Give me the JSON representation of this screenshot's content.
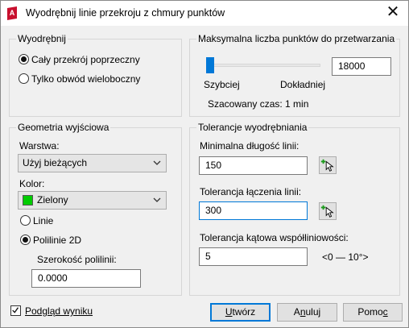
{
  "window": {
    "title": "Wyodrębnij linie przekroju z chmury punktów",
    "close_glyph": "✕"
  },
  "extract": {
    "title": "Wyodrębnij",
    "options": [
      {
        "label": "Cały przekrój poprzeczny",
        "selected": true
      },
      {
        "label": "Tylko obwód wieloboczny",
        "selected": false
      }
    ]
  },
  "max_points": {
    "title": "Maksymalna liczba punktów do przetwarzania",
    "slider_level": 0.05,
    "value": "18000",
    "left_label": "Szybciej",
    "right_label": "Dokładniej",
    "estimate": "Szacowany czas: 1 min"
  },
  "output": {
    "title": "Geometria wyjściowa",
    "layer_label": "Warstwa:",
    "layer_value": "Użyj bieżących",
    "color_label": "Kolor:",
    "color_value": "Zielony",
    "color_swatch": "#00cc00",
    "type_options": [
      {
        "label": "Linie",
        "selected": false
      },
      {
        "label": "Polilinie 2D",
        "selected": true
      }
    ],
    "width_label": "Szerokość polilinii:",
    "width_value": "0.0000"
  },
  "tolerance": {
    "title": "Tolerancje wyodrębniania",
    "min_length_label": "Minimalna długość linii:",
    "min_length_value": "150",
    "join_label": "Tolerancja łączenia linii:",
    "join_value": "300",
    "angle_label": "Tolerancja kątowa współliniowości:",
    "angle_value": "5",
    "angle_range": "<0 — 10°>"
  },
  "footer": {
    "preview_label": "Podgląd wyniku",
    "preview_checked": true,
    "create": {
      "first": "U",
      "rest": "twórz"
    },
    "cancel": {
      "first": "A",
      "mid": "n",
      "rest": "uluj"
    },
    "help": {
      "first": "Pomo",
      "u": "c"
    }
  },
  "colors": {
    "accent": "#0078d7",
    "icon_red": "#c8102e"
  }
}
